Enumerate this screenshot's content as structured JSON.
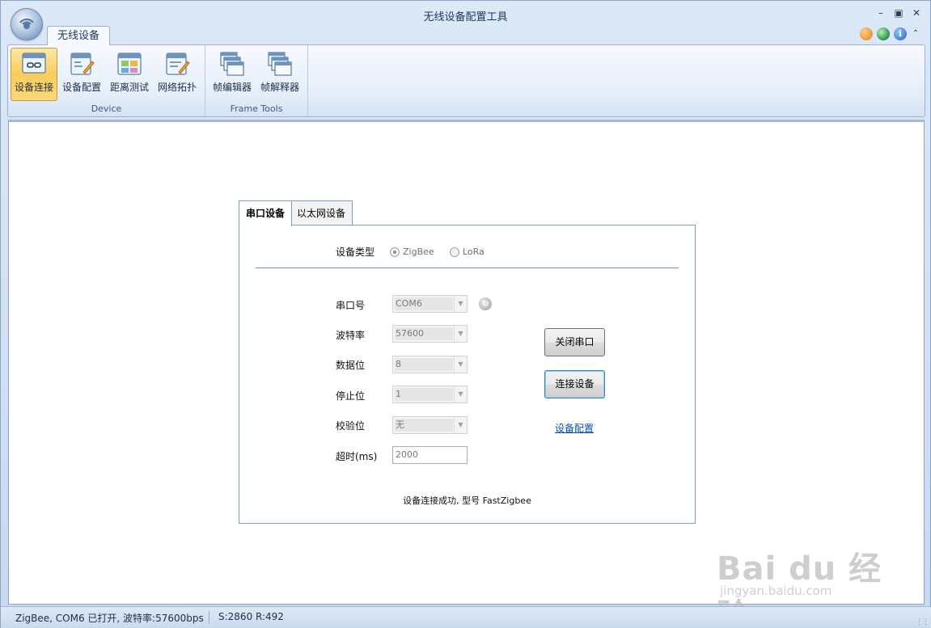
{
  "window": {
    "title": "无线设备配置工具",
    "controls": [
      "minimize",
      "maximize",
      "close"
    ]
  },
  "ribbon": {
    "tab_label": "无线设备",
    "groups": [
      {
        "label": "Device",
        "buttons": [
          {
            "label": "设备连接",
            "icon": "device-connect-icon",
            "active": true
          },
          {
            "label": "设备配置",
            "icon": "device-config-icon",
            "active": false
          },
          {
            "label": "距离测试",
            "icon": "distance-test-icon",
            "active": false
          },
          {
            "label": "网络拓扑",
            "icon": "network-topology-icon",
            "active": false
          }
        ]
      },
      {
        "label": "Frame Tools",
        "buttons": [
          {
            "label": "帧编辑器",
            "icon": "frame-editor-icon",
            "active": false
          },
          {
            "label": "帧解释器",
            "icon": "frame-parser-icon",
            "active": false
          }
        ]
      }
    ],
    "help_icons": [
      "palette-icon",
      "globe-icon",
      "info-icon",
      "collapse-ribbon-icon"
    ]
  },
  "tabs": {
    "serial": "串口设备",
    "ethernet": "以太网设备",
    "selected": "serial"
  },
  "form": {
    "device_type_label": "设备类型",
    "device_types": [
      {
        "label": "ZigBee",
        "checked": true
      },
      {
        "label": "LoRa",
        "checked": false
      }
    ],
    "port_label": "串口号",
    "port_value": "COM6",
    "baud_label": "波特率",
    "baud_value": "57600",
    "databits_label": "数据位",
    "databits_value": "8",
    "stopbits_label": "停止位",
    "stopbits_value": "1",
    "parity_label": "校验位",
    "parity_value": "无",
    "timeout_label": "超时(ms)",
    "timeout_value": "2000",
    "close_port_button": "关闭串口",
    "connect_button": "连接设备",
    "config_link": "设备配置",
    "status_message": "设备连接成功, 型号 FastZigbee"
  },
  "statusbar": {
    "port_status": "ZigBee, COM6 已打开, 波特率:57600bps",
    "sent": "S:2860",
    "received": "R:492"
  },
  "watermark": {
    "brand": "Bai du 经验",
    "url": "jingyan.baidu.com"
  },
  "colors": {
    "ribbon_active": "#f8cc5a",
    "link": "#0b4fa8",
    "panel_border": "#7f9db9"
  }
}
